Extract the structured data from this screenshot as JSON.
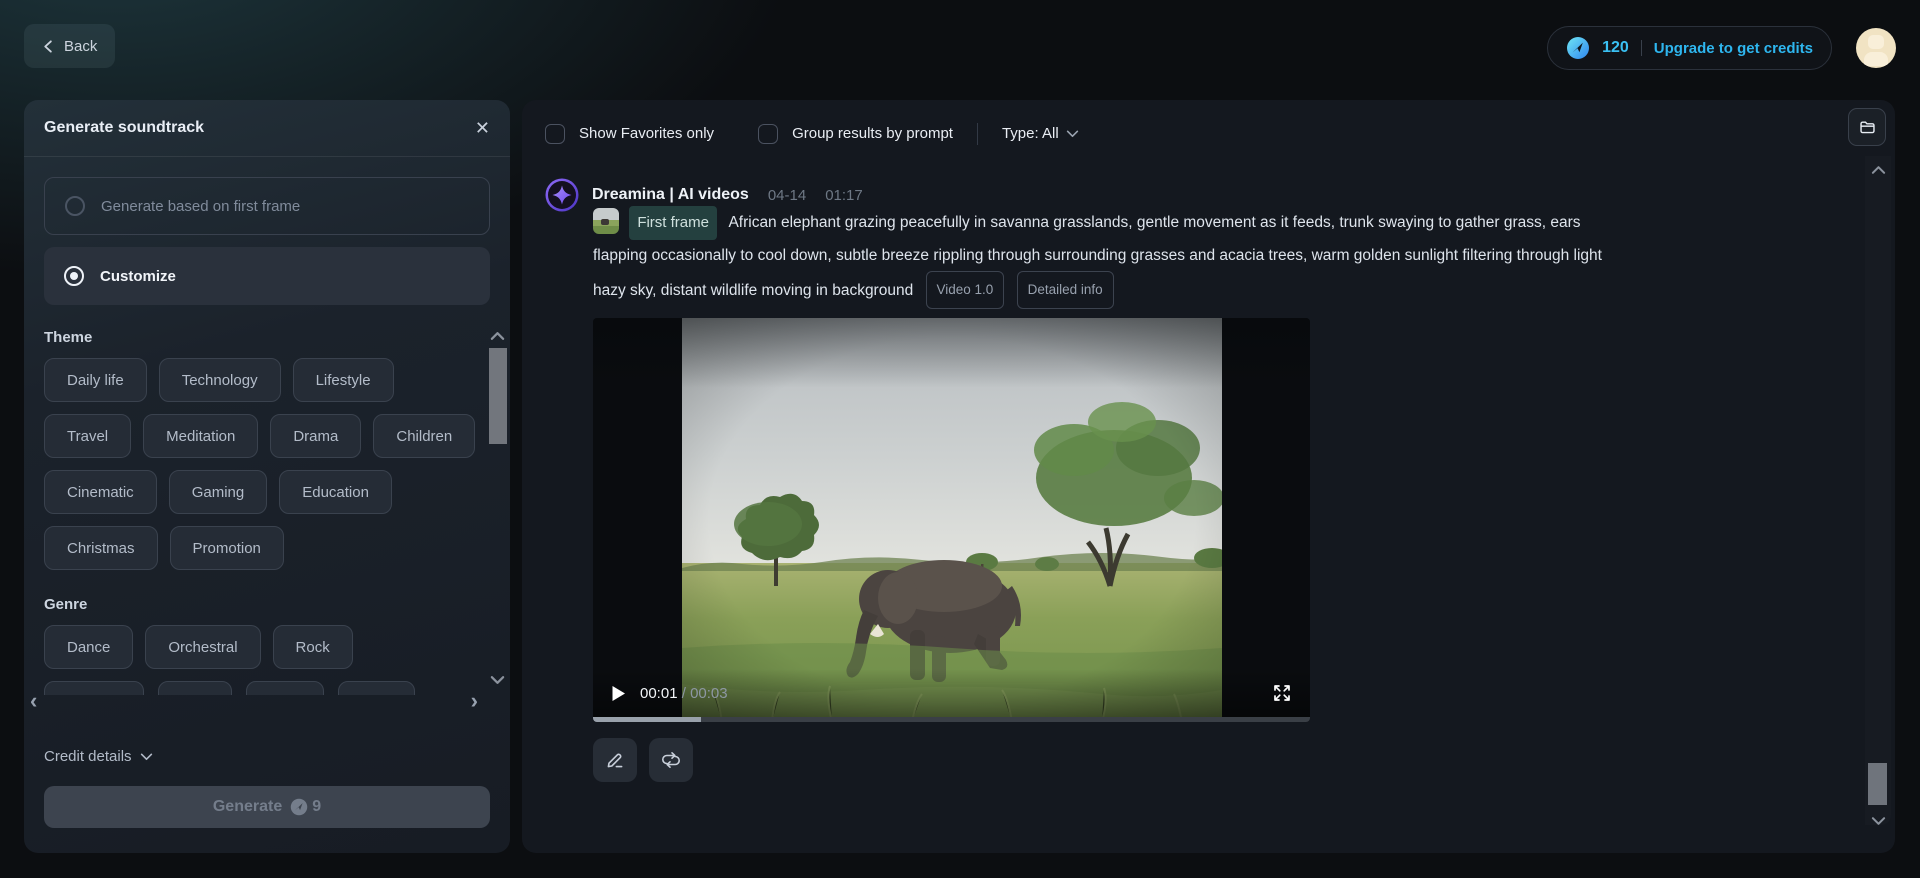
{
  "topbar": {
    "back": "Back",
    "credits": "120",
    "upgrade": "Upgrade to get credits"
  },
  "icons": {
    "close": "✕",
    "carousel_prev": "‹",
    "carousel_next": "›"
  },
  "sound_panel": {
    "title": "Generate soundtrack",
    "options": [
      {
        "label": "Generate based on first frame",
        "selected": false
      },
      {
        "label": "Customize",
        "selected": true
      }
    ],
    "theme": {
      "title": "Theme",
      "chips": [
        "Daily life",
        "Technology",
        "Lifestyle",
        "Travel",
        "Meditation",
        "Drama",
        "Children",
        "Cinematic",
        "Gaming",
        "Education",
        "Christmas",
        "Promotion"
      ]
    },
    "genre": {
      "title": "Genre",
      "chips": [
        "Dance",
        "Orchestral",
        "Rock"
      ]
    },
    "credit_details": "Credit details",
    "generate": {
      "label": "Generate",
      "cost": "9"
    }
  },
  "main": {
    "filters": {
      "show_favorites": "Show Favorites only",
      "group_results": "Group results by prompt",
      "type": "Type: All"
    },
    "post": {
      "author": "Dreamina | AI videos",
      "date": "04-14",
      "time": "01:17",
      "first_frame": "First frame",
      "prompt": "African elephant grazing peacefully in savanna grasslands, gentle movement as it feeds, trunk swaying to gather grass, ears flapping occasionally to cool down, subtle breeze rippling through surrounding grasses and acacia trees, warm golden sunlight filtering through light hazy sky, distant wildlife moving in background",
      "badges": [
        "Video 1.0",
        "Detailed info"
      ],
      "player": {
        "current": "00:01",
        "separator": "/",
        "duration": "00:03",
        "progress_pct": 15
      }
    }
  },
  "colors": {
    "accent_cyan": "#35c1f1",
    "brand_purple": "#8b63f7",
    "page_bg": "#0c0e11",
    "panel_bg": "#1b222b",
    "main_bg": "#14181f",
    "pill_teal_bg": "#24403f",
    "avatar_cream": "#f1e3c3"
  }
}
